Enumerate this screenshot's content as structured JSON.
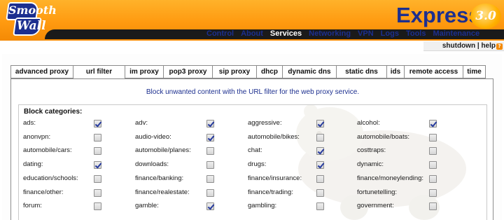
{
  "header": {
    "logo_line1": "Smooth",
    "logo_line2": "Wall",
    "product": "Express",
    "version": "3.0",
    "nav": [
      "Control",
      "About",
      "Services",
      "Networking",
      "VPN",
      "Logs",
      "Tools",
      "Maintenance"
    ],
    "active_nav": "Services"
  },
  "util": {
    "shutdown": "shutdown",
    "separator": " | ",
    "help": "help",
    "help_badge": "?"
  },
  "tabs": [
    "advanced proxy",
    "url filter",
    "im proxy",
    "pop3 proxy",
    "sip proxy",
    "dhcp",
    "dynamic dns",
    "static dns",
    "ids",
    "remote access",
    "time"
  ],
  "active_tab": "url filter",
  "intro": "Block unwanted content with the URL filter for the web proxy service.",
  "block_categories": {
    "legend": "Block categories:",
    "rows": [
      [
        {
          "label": "ads:",
          "checked": true
        },
        {
          "label": "adv:",
          "checked": true
        },
        {
          "label": "aggressive:",
          "checked": true
        },
        {
          "label": "alcohol:",
          "checked": true
        }
      ],
      [
        {
          "label": "anonvpn:",
          "checked": false
        },
        {
          "label": "audio-video:",
          "checked": true
        },
        {
          "label": "automobile/bikes:",
          "checked": false
        },
        {
          "label": "automobile/boats:",
          "checked": false
        }
      ],
      [
        {
          "label": "automobile/cars:",
          "checked": false
        },
        {
          "label": "automobile/planes:",
          "checked": false
        },
        {
          "label": "chat:",
          "checked": true
        },
        {
          "label": "costtraps:",
          "checked": false
        }
      ],
      [
        {
          "label": "dating:",
          "checked": true
        },
        {
          "label": "downloads:",
          "checked": false
        },
        {
          "label": "drugs:",
          "checked": true
        },
        {
          "label": "dynamic:",
          "checked": false
        }
      ],
      [
        {
          "label": "education/schools:",
          "checked": false
        },
        {
          "label": "finance/banking:",
          "checked": false
        },
        {
          "label": "finance/insurance:",
          "checked": false
        },
        {
          "label": "finance/moneylending:",
          "checked": false
        }
      ],
      [
        {
          "label": "finance/other:",
          "checked": false
        },
        {
          "label": "finance/realestate:",
          "checked": false
        },
        {
          "label": "finance/trading:",
          "checked": false
        },
        {
          "label": "fortunetelling:",
          "checked": false
        }
      ],
      [
        {
          "label": "forum:",
          "checked": false
        },
        {
          "label": "gamble:",
          "checked": true
        },
        {
          "label": "gambling:",
          "checked": false
        },
        {
          "label": "government:",
          "checked": false
        }
      ]
    ]
  },
  "colors": {
    "header_orange": "#ff9a10",
    "brand_blue": "#1c2f8f",
    "check_blue": "#263a9e"
  }
}
